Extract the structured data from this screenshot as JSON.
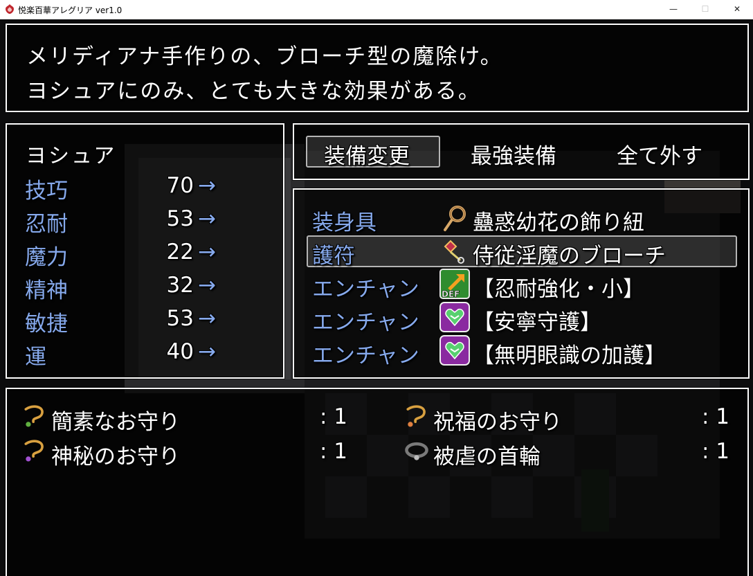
{
  "window": {
    "title": "悦楽百華アレグリア ver1.0",
    "minimize_glyph": "—",
    "maximize_glyph": "☐",
    "close_glyph": "✕"
  },
  "help": {
    "line1": "メリディアナ手作りの、ブローチ型の魔除け。",
    "line2": "ヨシュアにのみ、とても大きな効果がある。"
  },
  "status": {
    "actor_name": "ヨシュア",
    "params": [
      {
        "label": "技巧",
        "value": "70",
        "arrow": "→"
      },
      {
        "label": "忍耐",
        "value": "53",
        "arrow": "→"
      },
      {
        "label": "魔力",
        "value": "22",
        "arrow": "→"
      },
      {
        "label": "精神",
        "value": "32",
        "arrow": "→"
      },
      {
        "label": "敏捷",
        "value": "53",
        "arrow": "→"
      },
      {
        "label": "運",
        "value": "40",
        "arrow": "→"
      }
    ]
  },
  "commands": {
    "items": [
      "装備変更",
      "最強装備",
      "全て外す"
    ],
    "selected_index": 0
  },
  "slots": {
    "selected_index": 1,
    "rows": [
      {
        "type": "装身具",
        "icon": "rope-cord-icon",
        "item": "蠱惑幼花の飾り紐"
      },
      {
        "type": "護符",
        "icon": "brooch-charm-icon",
        "item": "侍従淫魔のブローチ"
      },
      {
        "type": "エンチャン",
        "icon": "def-up-icon",
        "icon_text": "DEF",
        "item": "【忍耐強化・小】"
      },
      {
        "type": "エンチャン",
        "icon": "heart-shield-icon",
        "item": "【安寧守護】"
      },
      {
        "type": "エンチャン",
        "icon": "heart-shield-icon",
        "item": "【無明眼識の加護】"
      }
    ]
  },
  "inventory": {
    "items": [
      {
        "name": "簡素なお守り",
        "icon": "amulet-cord-icon",
        "count": ": 1"
      },
      {
        "name": "祝福のお守り",
        "icon": "amulet-cord-icon",
        "count": ": 1"
      },
      {
        "name": "神秘のお守り",
        "icon": "amulet-cord-icon",
        "count": ": 1"
      },
      {
        "name": "被虐の首輪",
        "icon": "collar-icon",
        "count": ": 1"
      }
    ]
  },
  "colors": {
    "system_text": "#86a9ec",
    "normal_text": "#ffffff",
    "window_border": "#ffffff",
    "window_fill": "rgba(0,0,0,0.62)"
  }
}
